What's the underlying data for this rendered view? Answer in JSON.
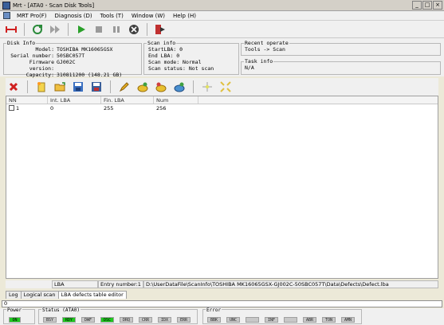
{
  "window": {
    "title": "Mrt - [ATA0 - Scan Disk Tools]"
  },
  "menu": [
    {
      "label": "MRT Pro(F)"
    },
    {
      "label": "Diagnosis (D)"
    },
    {
      "label": "Tools (T)"
    },
    {
      "label": "Window (W)"
    },
    {
      "label": "Help (H)"
    }
  ],
  "disk_info": {
    "legend": "Disk Info",
    "fields": [
      {
        "key": "Model:",
        "value": "TOSHIBA MK16065GSX"
      },
      {
        "key": "Serial number:",
        "value": "50SBC057T"
      },
      {
        "key": "Firmware version:",
        "value": "GJ002C"
      },
      {
        "key": "Capacity:",
        "value": "310811200 (148.21 GB)"
      }
    ]
  },
  "scan_info": {
    "legend": "Scan info",
    "fields": [
      {
        "text": "StartLBA: 0"
      },
      {
        "text": "End LBA: 0"
      },
      {
        "text": "Scan mode: Normal"
      },
      {
        "text": "Scan status: Not scan"
      }
    ]
  },
  "recent_operate": {
    "legend": "Recent operate",
    "value": "Tools -> Scan"
  },
  "task_info": {
    "legend": "Task info",
    "value": "N/A"
  },
  "table": {
    "columns": [
      "NN",
      "Int. LBA",
      "Fin. LBA",
      "Num"
    ],
    "rows": [
      {
        "nn": "1",
        "int_lba": "0",
        "fin_lba": "255",
        "num": "256"
      }
    ]
  },
  "status_line": {
    "lba_label": "LBA",
    "entry": "Entry number:1",
    "path": "D:\\UserDataFile\\ScanInfo\\TOSHIBA MK16065GSX-GJ002C-50SBC057T\\Data\\Defects\\Defect.lba"
  },
  "tabs": [
    {
      "label": "Log"
    },
    {
      "label": "Logical scan"
    },
    {
      "label": "LBA defects table editor"
    }
  ],
  "progress": {
    "value": "0"
  },
  "power": {
    "label": "Power",
    "indicators": [
      {
        "label": "ON",
        "on": true
      }
    ]
  },
  "status": {
    "label": "Status (ATA0)",
    "indicators": [
      {
        "label": "BSY",
        "on": false
      },
      {
        "label": "RDY",
        "on": true
      },
      {
        "label": "DWF",
        "on": false
      },
      {
        "label": "DSC",
        "on": true
      },
      {
        "label": "DRQ",
        "on": false
      },
      {
        "label": "CRR",
        "on": false
      },
      {
        "label": "IDX",
        "on": false
      },
      {
        "label": "ERR",
        "on": false
      }
    ]
  },
  "error": {
    "label": "Error",
    "indicators": [
      {
        "label": "BBK",
        "on": false
      },
      {
        "label": "UNC",
        "on": false
      },
      {
        "label": "",
        "on": false
      },
      {
        "label": "INF",
        "on": false
      },
      {
        "label": "",
        "on": false
      },
      {
        "label": "ABR",
        "on": false
      },
      {
        "label": "TON",
        "on": false
      },
      {
        "label": "AMN",
        "on": false
      }
    ]
  },
  "colors": {
    "indicator_on": "#1ec81e",
    "indicator_off": "#c8c8c8"
  }
}
